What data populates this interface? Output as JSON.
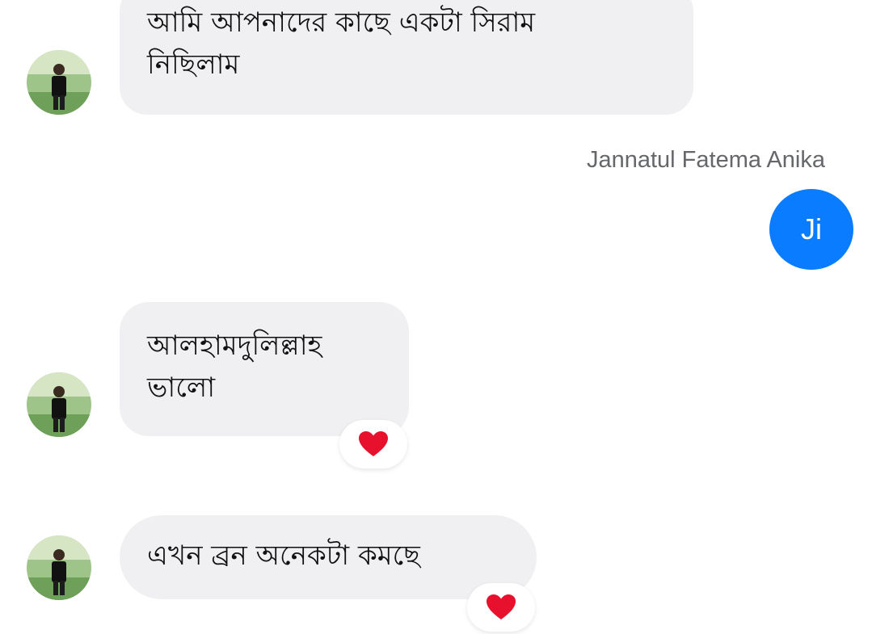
{
  "conversation": {
    "messages": [
      {
        "direction": "incoming",
        "lines": [
          "আমি আপনাদের কাছে একটা সিরাম",
          "নিছিলাম"
        ],
        "reaction": null
      },
      {
        "direction": "outgoing",
        "sender": "Jannatul Fatema Anika",
        "text": "Ji"
      },
      {
        "direction": "incoming",
        "lines": [
          "আলহামদুলিল্লাহ",
          "ভালো"
        ],
        "reaction": "heart-icon"
      },
      {
        "direction": "incoming",
        "lines": [
          "এখন ব্রন অনেকটা কমছে"
        ],
        "reaction": "heart-icon"
      }
    ]
  },
  "colors": {
    "incoming_bubble": "#f0f0f2",
    "outgoing_bubble": "#0a7cff",
    "sender_name": "#65676b",
    "reaction_heart": "#e8112d"
  }
}
